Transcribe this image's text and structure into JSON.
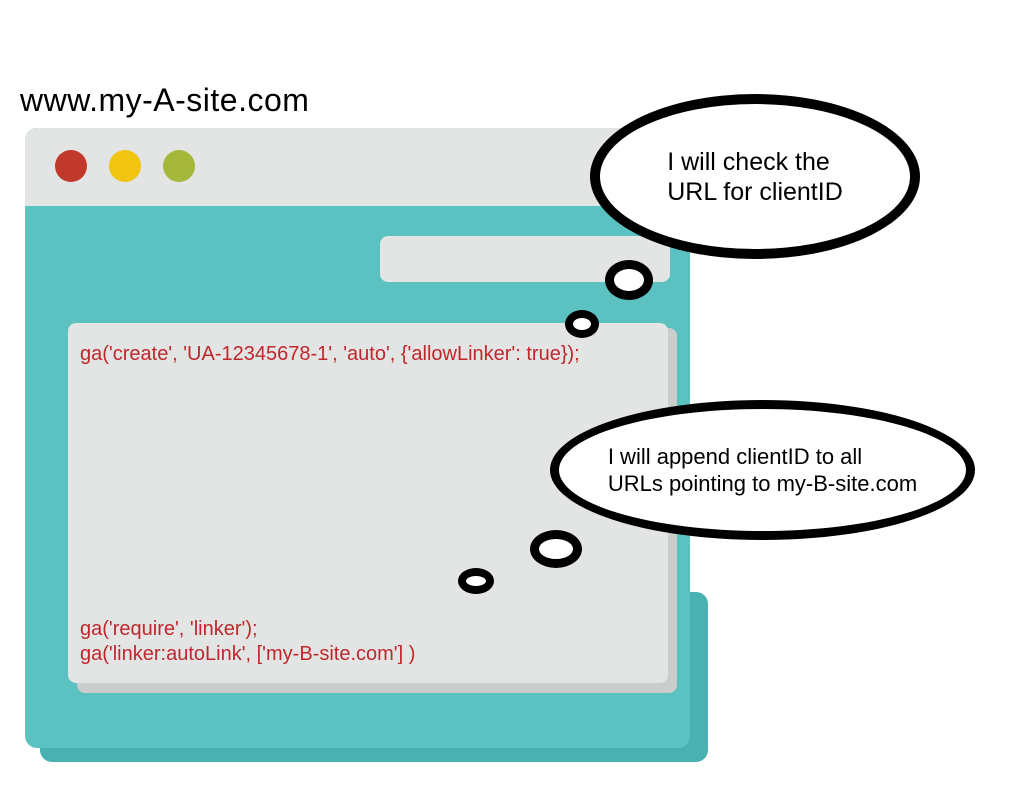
{
  "url_label": "www.my-A-site.com",
  "code": {
    "line1": "ga('create', 'UA-12345678-1', 'auto', {'allowLinker': true});",
    "line2": "ga('require', 'linker');",
    "line3": "ga('linker:autoLink', ['my-B-site.com'] )"
  },
  "bubble1": {
    "line1": "I will check the",
    "line2": "URL for clientID"
  },
  "bubble2": {
    "line1": "I will append clientID to all",
    "line2": "URLs pointing to my-B-site.com"
  },
  "colors": {
    "browser_teal": "#5bc1c1",
    "browser_shadow": "#49b1b2",
    "chrome_gray": "#e2e5e3",
    "code_red": "#c0272d",
    "tl_red": "#c0392b",
    "tl_yellow": "#f1c40f",
    "tl_green": "#a4b73a"
  }
}
